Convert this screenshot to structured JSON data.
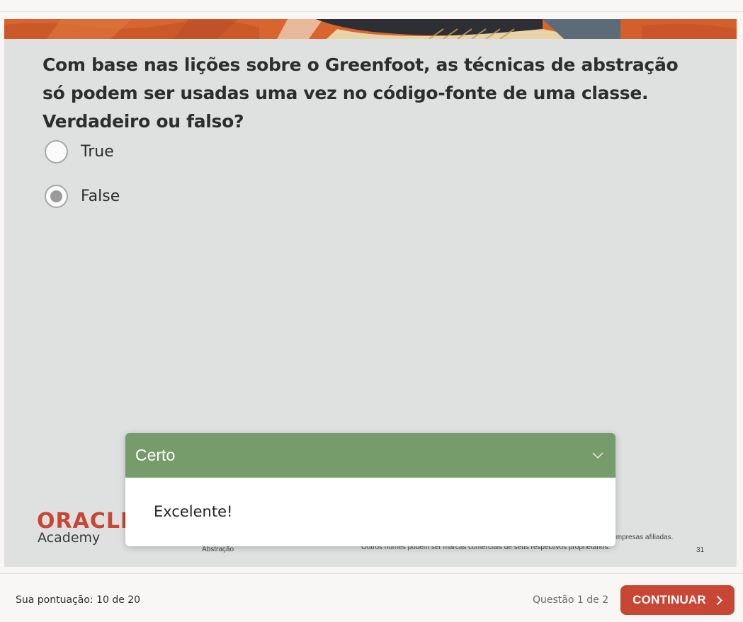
{
  "question": {
    "text": "Com base nas lições sobre o Greenfoot, as técnicas de abstração só podem ser usadas uma vez no código-fonte de uma classe. Verdadeiro ou falso?",
    "options": [
      {
        "label": "True",
        "selected": false
      },
      {
        "label": "False",
        "selected": true
      }
    ]
  },
  "slide_footer": {
    "logo_text": "ORACLE",
    "academy": "Academy",
    "topic": "Abstração",
    "legal": "MySQL são marcas comerciais registradas da Oracle Corporation e/ou de suas empresas afiliadas. Outros nomes podem ser marcas comerciais de seus respectivos proprietários.",
    "page_number": "31"
  },
  "feedback": {
    "title": "Certo",
    "message": "Excelente!",
    "header_color": "#759c6a",
    "icon": "chevron-down-icon"
  },
  "bottom_bar": {
    "score": "Sua pontuação: 10 de 20",
    "progress": "Questão 1 de 2",
    "continue_label": "CONTINUAR",
    "continue_icon": "chevron-right-icon",
    "accent_color": "#c74634"
  }
}
